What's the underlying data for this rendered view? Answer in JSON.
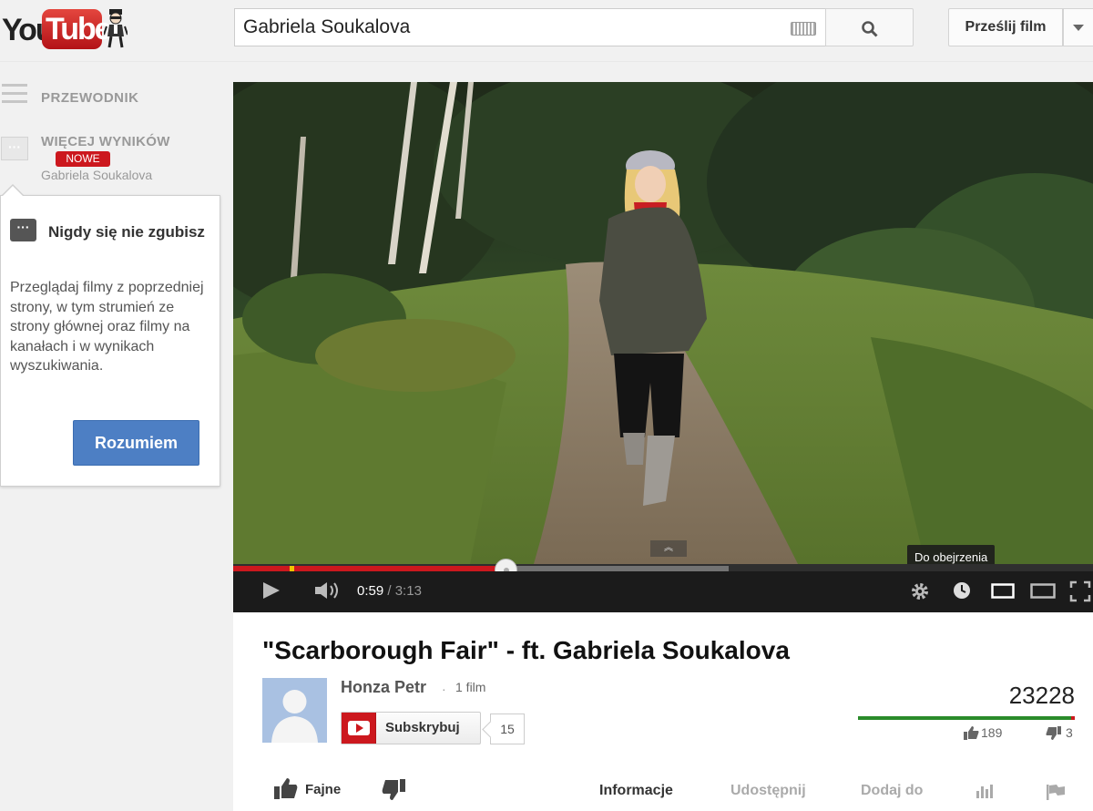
{
  "header": {
    "logo_text_you": "You",
    "logo_text_tube": "Tube",
    "search_value": "Gabriela Soukalova",
    "upload_label": "Prześlij film"
  },
  "guide": {
    "guide_label": "PRZEWODNIK",
    "more_label": "WIĘCEJ WYNIKÓW",
    "new_badge": "NOWE",
    "more_sub": "Gabriela Soukalova"
  },
  "tooltip": {
    "title": "Nigdy się nie zgubisz",
    "body": "Przeglądaj filmy z poprzedniej strony, w tym strumień ze strony głównej oraz filmy na kanałach i w wynikach wyszukiwania.",
    "button": "Rozumiem"
  },
  "player": {
    "current_time": "0:59",
    "separator": " / ",
    "duration": "3:13",
    "watch_later_tooltip": "Do obejrzenia",
    "played_fraction": 0.318,
    "buffered_fraction": 0.576
  },
  "video": {
    "title": "\"Scarborough Fair\" - ft. Gabriela Soukalova",
    "channel_name": "Honza Petr",
    "dot": "·",
    "video_count": "1 film",
    "subscribe_label": "Subskrybuj",
    "subscriber_count": "15",
    "views": "23228",
    "likes": "189",
    "dislikes": "3",
    "like_ratio": 0.984
  },
  "actions": {
    "like_label": "Fajne",
    "tabs": [
      {
        "label": "Informacje",
        "active": true
      },
      {
        "label": "Udostępnij",
        "active": false
      },
      {
        "label": "Dodaj do",
        "active": false
      }
    ]
  },
  "colors": {
    "accent_red": "#cc181e",
    "button_blue": "#4d7fc4",
    "like_green": "#2a8b2a"
  }
}
